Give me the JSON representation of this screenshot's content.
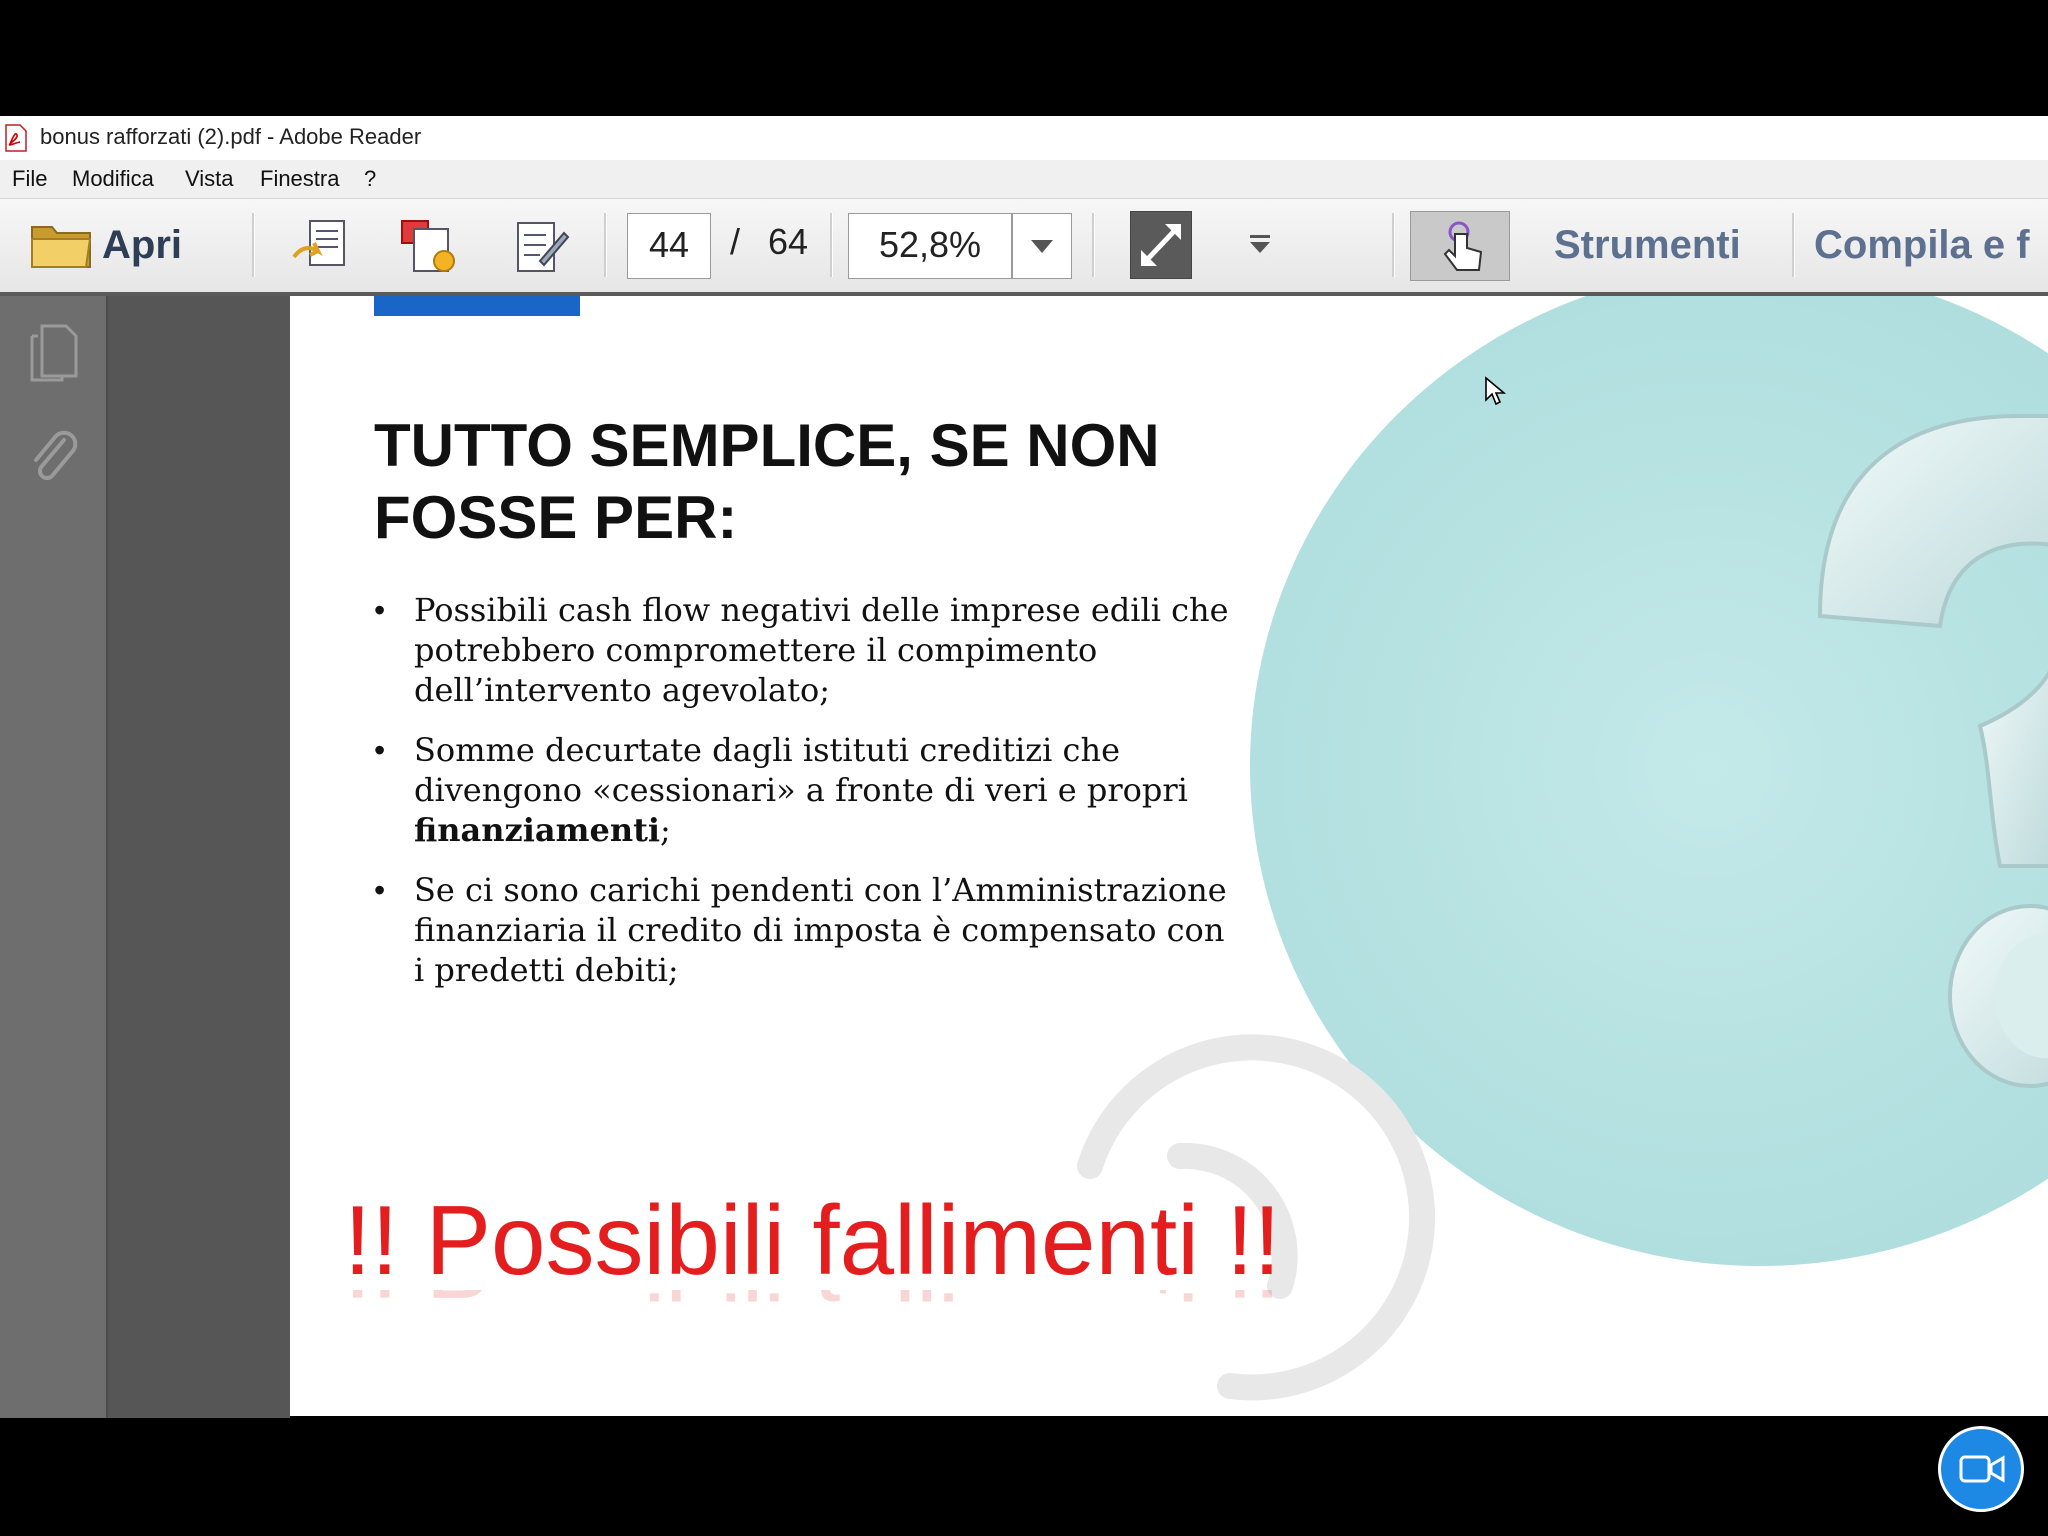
{
  "window": {
    "title": "bonus rafforzati  (2).pdf - Adobe Reader",
    "icon": "pdf-file-icon"
  },
  "menu": [
    "File",
    "Modifica",
    "Vista",
    "Finestra",
    "?"
  ],
  "toolbar": {
    "open_label": "Apri",
    "page_current": "44",
    "page_separator": "/",
    "page_total": "64",
    "zoom": "52,8%",
    "tools_label": "Strumenti",
    "fill_sign_label": "Compila e f"
  },
  "slide": {
    "title_line1": "TUTTO SEMPLICE, SE NON",
    "title_line2": "FOSSE PER:",
    "bullet1": "Possibili cash flow negativi delle imprese edili che potrebbero compromettere il compimento dell’intervento agevolato;",
    "bullet2_prefix": "Somme decurtate dagli istituti creditizi che divengono «cessionari» a fronte di veri e propri ",
    "bullet2_bold": "finanziamenti",
    "bullet2_suffix": ";",
    "bullet3": "Se ci sono carichi pendenti con l’Amministrazione finanziaria il credito di imposta è compensato con i predetti debiti;",
    "highlight": "!! Possibili fallimenti !!"
  },
  "colors": {
    "accent_blue": "#1a66c8",
    "highlight_red": "#e41e1e",
    "teal": "#b3e0e0",
    "tool_label": "#5d7090"
  }
}
